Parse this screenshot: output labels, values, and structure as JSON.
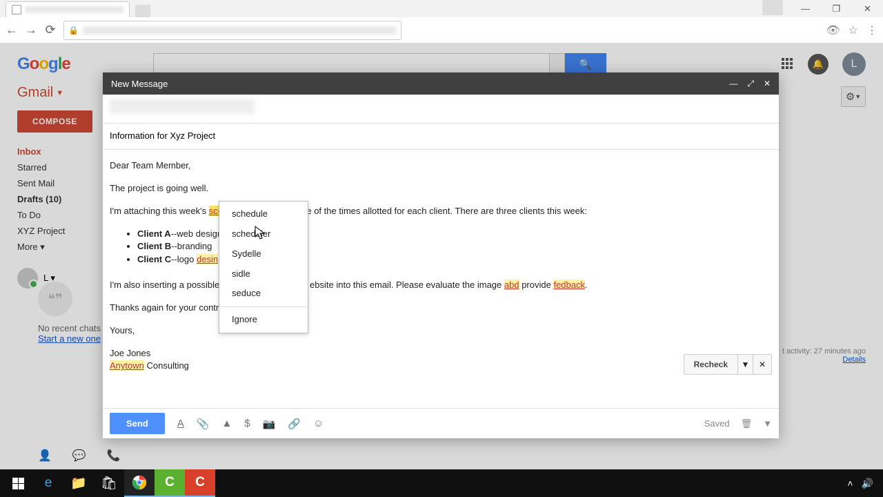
{
  "browser": {
    "tab_title": ""
  },
  "window_controls": {
    "minimize": "—",
    "maximize": "❐",
    "close": "✕"
  },
  "gmail": {
    "logo": [
      "G",
      "o",
      "o",
      "g",
      "l",
      "e"
    ],
    "brand": "Gmail",
    "avatar_initial": "L",
    "compose": "COMPOSE",
    "folders": [
      {
        "label": "Inbox",
        "active": true
      },
      {
        "label": "Starred"
      },
      {
        "label": "Sent Mail"
      },
      {
        "label": "Drafts (10)",
        "bold": true
      },
      {
        "label": "To Do"
      },
      {
        "label": "XYZ Project"
      },
      {
        "label": "More ▾"
      }
    ],
    "user_chip": "L ▾",
    "hangouts": {
      "no_chats": "No recent chats",
      "start": "Start a new one"
    },
    "activity": {
      "line": "t activity: 27 minutes ago",
      "details": "Details"
    },
    "gear": "⚙"
  },
  "compose": {
    "title": "New Message",
    "subject": "Information for Xyz Project",
    "body": {
      "greeting": "Dear Team Member,",
      "p1": "The project is going well.",
      "p2a": "I'm attaching this week's ",
      "misspell1": "scedule",
      "p2b": ". Please take note of the times allotted for each client. There are three clients this week:",
      "clients": [
        {
          "name": "Client A",
          "desc": "--web design"
        },
        {
          "name": "Client B",
          "desc": "--branding"
        },
        {
          "name": "Client C",
          "desc": "--logo ",
          "misspell": "desin"
        }
      ],
      "p3a": "I'm also inserting a possible",
      "p3b": "ebsite into this email. Please evaluate the image ",
      "misspell2": "abd",
      "p3c": " provide ",
      "misspell3": "fedback",
      "p3d": ".",
      "p4": "Thanks again for your contri",
      "closing": "Yours,",
      "sig1": "Joe Jones",
      "sig2a": "Anytown",
      "sig2b": " Consulting"
    },
    "spellcheck": {
      "suggestions": [
        "schedule",
        "scheduler",
        "Sydelle",
        "sidle",
        "seduce"
      ],
      "ignore": "Ignore"
    },
    "recheck": "Recheck",
    "footer": {
      "send": "Send",
      "saved": "Saved"
    }
  },
  "taskbar": {
    "clock": "",
    "items": [
      "start",
      "edge",
      "files",
      "store",
      "chrome",
      "camtasia",
      "rec"
    ]
  }
}
